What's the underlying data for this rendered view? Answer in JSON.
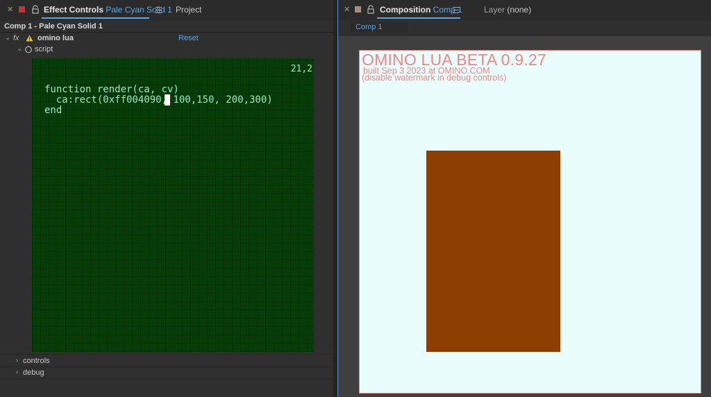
{
  "effect_controls": {
    "tab_title": "Effect Controls",
    "tab_subject": "Pale Cyan Solid 1",
    "tab_project": "Project",
    "breadcrumb": "Comp 1 - Pale Cyan Solid 1",
    "fx_label": "fx",
    "effect_name": "omino lua",
    "reset_label": "Reset",
    "script_label": "script",
    "controls_label": "controls",
    "debug_label": "debug"
  },
  "editor": {
    "cursor_pos": "21,2",
    "code": "function render(ca, cv)\n  ca:rect(0xff004090, 100,150, 200,300)\nend"
  },
  "composition": {
    "tab_title": "Composition",
    "tab_subject": "Comp 1",
    "layer_label": "Layer",
    "layer_value": "(none)",
    "subtab": "Comp 1"
  },
  "canvas": {
    "watermark_title": "OMINO LUA BETA 0.9.27",
    "watermark_built": "built Sep  3 2023 at OMINO.COM",
    "watermark_hint": "(disable watermark in debug controls)",
    "background_color": "#e9fdfd",
    "rect_color": "#8c3f01"
  },
  "colors": {
    "accent": "#5aa7ea",
    "editor_bg": "#053d06",
    "code_text": "#9be8c8",
    "watermark": "#f08585"
  }
}
